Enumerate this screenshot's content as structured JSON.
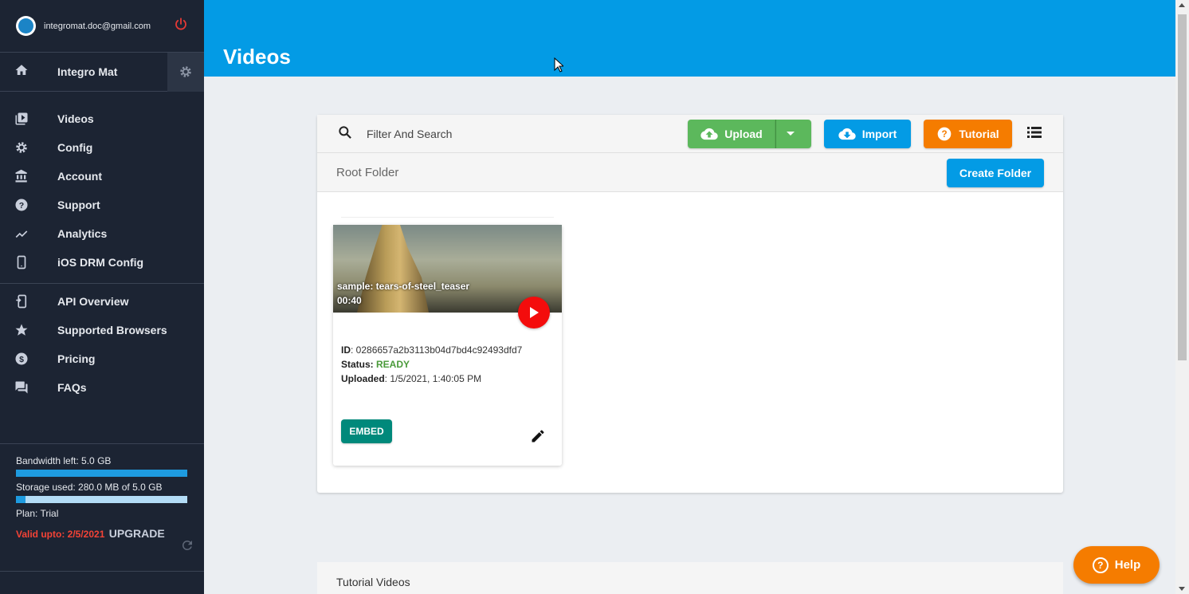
{
  "user": {
    "email": "integromat.doc@gmail.com"
  },
  "project": {
    "name": "Integro Mat"
  },
  "nav": {
    "primary": [
      {
        "label": "Videos",
        "icon": "video-library-icon"
      },
      {
        "label": "Config",
        "icon": "gear-icon"
      },
      {
        "label": "Account",
        "icon": "bank-icon"
      },
      {
        "label": "Support",
        "icon": "help-circle-icon"
      },
      {
        "label": "Analytics",
        "icon": "trend-line-icon"
      },
      {
        "label": "iOS DRM Config",
        "icon": "phone-icon"
      }
    ],
    "secondary": [
      {
        "label": "API Overview",
        "icon": "api-phone-icon"
      },
      {
        "label": "Supported Browsers",
        "icon": "star-icon"
      },
      {
        "label": "Pricing",
        "icon": "dollar-icon"
      },
      {
        "label": "FAQs",
        "icon": "chat-icon"
      }
    ]
  },
  "usage": {
    "bandwidth_text": "Bandwidth left: 5.0 GB",
    "bandwidth_fraction": 1.0,
    "storage_text": "Storage used: 280.0 MB of 5.0 GB",
    "storage_fraction": 0.056,
    "plan_text": "Plan: Trial",
    "valid_text": "Valid upto: 2/5/2021",
    "upgrade_label": "UPGRADE"
  },
  "header": {
    "title": "Videos"
  },
  "toolbar": {
    "search_placeholder": "Filter And Search",
    "upload_label": "Upload",
    "import_label": "Import",
    "tutorial_label": "Tutorial"
  },
  "folder": {
    "title": "Root Folder",
    "create_label": "Create Folder"
  },
  "video": {
    "title": "sample: tears-of-steel_teaser",
    "duration": "00:40",
    "id_label": "ID",
    "id": ": 0286657a2b3113b04d7bd4c92493dfd7",
    "status_label": "Status:",
    "status": "READY",
    "uploaded_label": "Uploaded",
    "uploaded": ": 1/5/2021, 1:40:05 PM",
    "embed_label": "EMBED"
  },
  "tutorials": {
    "title": "Tutorial Videos"
  },
  "help": {
    "label": "Help"
  },
  "colors": {
    "header": "#039be5",
    "sidebar": "#1c2433",
    "upload": "#5cb85c",
    "tutorial": "#f57c00",
    "embed": "#00897b",
    "play": "#f40c0c"
  }
}
